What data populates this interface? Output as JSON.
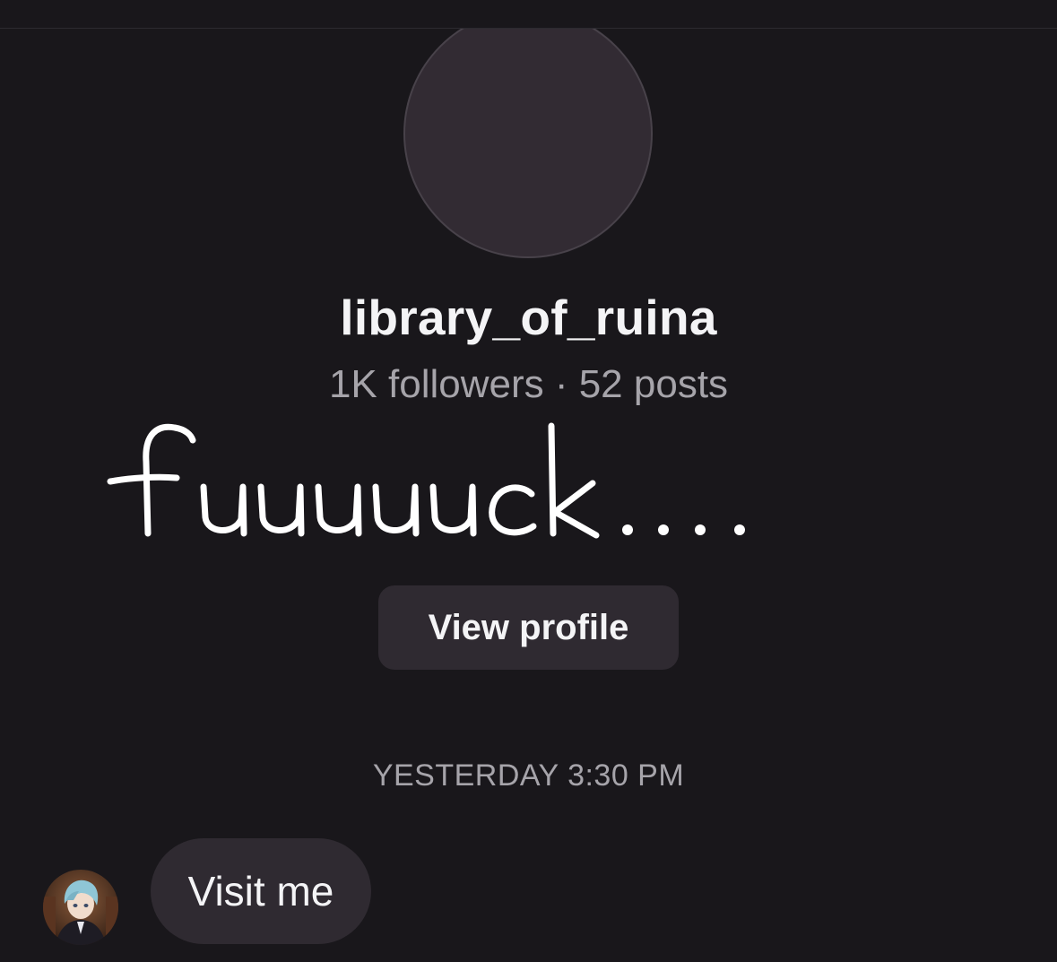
{
  "profile": {
    "username": "library_of_ruina",
    "stats": "1K followers · 52 posts",
    "view_profile_label": "View profile"
  },
  "overlay": {
    "handwritten_text": "fuuuuuck...."
  },
  "thread": {
    "timestamp": "YESTERDAY 3:30 PM",
    "messages": [
      {
        "text": "Visit me",
        "sender_avatar": "anime-character-avatar"
      }
    ]
  },
  "colors": {
    "background": "#19171b",
    "bubble": "#2f2a31",
    "primary_text": "#f4f4f6",
    "secondary_text": "#a6a4aa",
    "avatar_placeholder": "#322b33"
  }
}
